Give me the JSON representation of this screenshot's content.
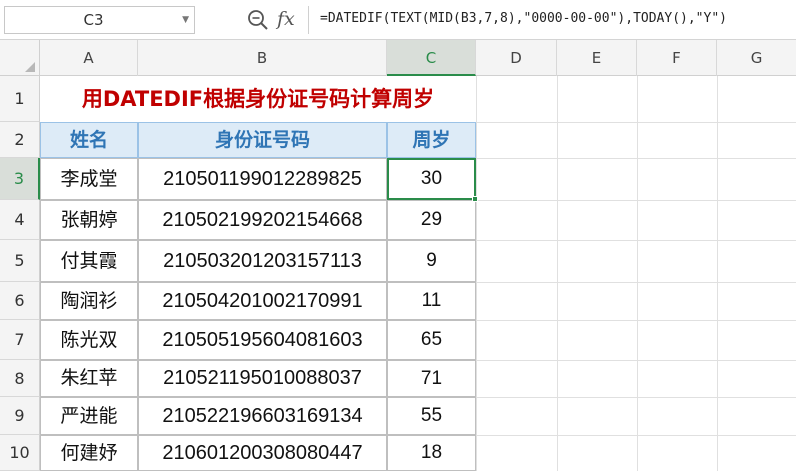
{
  "formula_bar": {
    "name_box": "C3",
    "formula": "=DATEDIF(TEXT(MID(B3,7,8),\"0000-00-00\"),TODAY(),\"Y\")",
    "fx_label": "fx"
  },
  "columns": [
    "A",
    "B",
    "C",
    "D",
    "E",
    "F",
    "G"
  ],
  "rows": [
    "1",
    "2",
    "3",
    "4",
    "5",
    "6",
    "7",
    "8",
    "9",
    "10"
  ],
  "title": "用DATEDIF根据身份证号码计算周岁",
  "table": {
    "headers": [
      "姓名",
      "身份证号码",
      "周岁"
    ],
    "rows": [
      {
        "name": "李成堂",
        "id": "210501199012289825",
        "age": "30"
      },
      {
        "name": "张朝婷",
        "id": "210502199202154668",
        "age": "29"
      },
      {
        "name": "付其霞",
        "id": "210503201203157113",
        "age": "9"
      },
      {
        "name": "陶润衫",
        "id": "210504201002170991",
        "age": "11"
      },
      {
        "name": "陈光双",
        "id": "210505195604081603",
        "age": "65"
      },
      {
        "name": "朱红苹",
        "id": "210521195010088037",
        "age": "71"
      },
      {
        "name": "严进能",
        "id": "210522196603169134",
        "age": "55"
      },
      {
        "name": "何建妤",
        "id": "210601200308080447",
        "age": "18"
      }
    ]
  },
  "selection": {
    "cell": "C3",
    "column": "C",
    "row": "3"
  },
  "colors": {
    "title": "#c00000",
    "header_bg": "#ddebf7",
    "header_text": "#2f75b5",
    "selection": "#2a8c4a"
  }
}
